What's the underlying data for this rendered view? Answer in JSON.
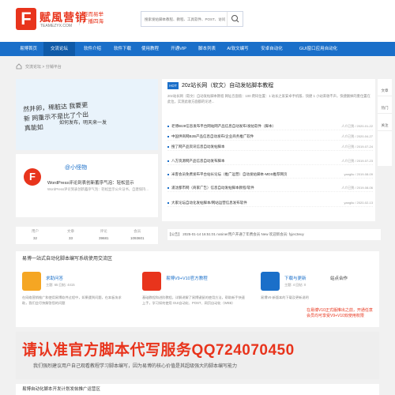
{
  "logo": {
    "letter": "F",
    "name": "赋風营销",
    "domain": "TEAMEZYX.COM",
    "slogan1": "轻而易举",
    "slogan2": "广播四海"
  },
  "search": {
    "placeholder": "搜索发帖脚本教程、教程、工具软件、POST、访问"
  },
  "nav": [
    "易博首页",
    "交流论坛",
    "软件介绍",
    "软件下载",
    "使用教程",
    "开通VIP",
    "脚本列表",
    "AI软文编写",
    "安卓自动化",
    "GUI窗口应用自动化"
  ],
  "breadcrumb": "交流论坛 > 分销平台",
  "ad_left": {
    "text": "然并卵，稀脏达 我要更新 网重示不是比了个出真能如",
    "sub": "如何发布，明天来一发"
  },
  "hot": {
    "badge": "HOT",
    "headline": "20z站长网（软文）自动发帖脚本教程",
    "desc": "20z站长网（软文）自动发帖脚本教程 网址百面值：100 爬码位置：1 站长之家安卓手机版、快捷 1 小站来收不声，快捷删掉的重位置在此位，实测此收方面都的论述..."
  },
  "list": [
    {
      "title": "老博BI28信息发布平台网站网产品信息自动发布/发帖软件（脚本）",
      "date": "人介已到 / 2020-01-22"
    },
    {
      "title": "中国供商网B2B产品信息自动发布/企业商务推广软件",
      "date": "人介已到 / 2020-04-27"
    },
    {
      "title": "搜了网产品资讯信息自动发帖脚本",
      "date": "人介已到 / 2019-07-24"
    },
    {
      "title": "八方资源网产品信息自动发布脚本",
      "date": "人介已到 / 2019-07-23"
    },
    {
      "title": "米客会员免费发布平台站长论坛（推广运营）自动发帖脚本-MDS推荐网页",
      "date": "yangliu / 2019-08-09"
    },
    {
      "title": "浦沈都市网（商家广告）信息自动发帖脚本教程/软件",
      "date": "人介已到 / 2019-08-06"
    },
    {
      "title": "大家论坛自动化发帖脚本/网站运营信息发布软件",
      "date": "yangliu / 2020-02-13"
    }
  ],
  "article": {
    "author": "@小怪物",
    "title": "WordPress评论到表创新蓄序气泡：轻松显示",
    "text": "WordPress评论到表创新蓄序气泡：轻松显示公众证书，自建保持..."
  },
  "stats": [
    {
      "label": "用户",
      "value": "32"
    },
    {
      "label": "文章",
      "value": "33"
    },
    {
      "label": "评论",
      "value": "39681"
    },
    {
      "label": "会员",
      "value": "1093601"
    }
  ],
  "notice": "【公告】 2025-01-14 16:51:01 nxsiner用户开通了年费会员  New  欢迎新会员: fyjec3euy",
  "section": {
    "title": "易博一站式自动化脚本编写系统使用交流区",
    "cards": [
      {
        "title": "求助问答",
        "meta": "主题: 65   回帖: 4415",
        "text": "在网络营销推广和使用易博软件过程中，如果遇到问题，在本板块求助，我们会尽快解答您的问题"
      },
      {
        "title": "易博V9+V10官方教程",
        "meta": "",
        "text": "基础教程和进阶教程，详解讲解了易博键鼠的使用方法，帮助新手快速上手，学习如何使用 GUI自动化、POST、网页自动化（WEB）"
      },
      {
        "title": "下载与更新",
        "meta": "主题: 4   回帖: 0",
        "text": "易博V9 新版本的下载及更新说明"
      }
    ],
    "right": {
      "label": "站点合作",
      "promo": "在易博V10正式版推出之前，开通任意会员均可享受V9+V10双使用权限"
    }
  },
  "banner": {
    "big": "请认准官方脚本代写服务QQ724070450",
    "small": "我们强烈建议用户自己观看教程学习脚本编写，因为易博的核心价值是其超级强大的脚本编写能力"
  },
  "bottom": "易博自动化脚本开发计划发帖推广运营区",
  "side": [
    "文章",
    "热门",
    "关注"
  ],
  "colors": {
    "brand": "#e8341c",
    "nav": "#1a6fc9"
  }
}
